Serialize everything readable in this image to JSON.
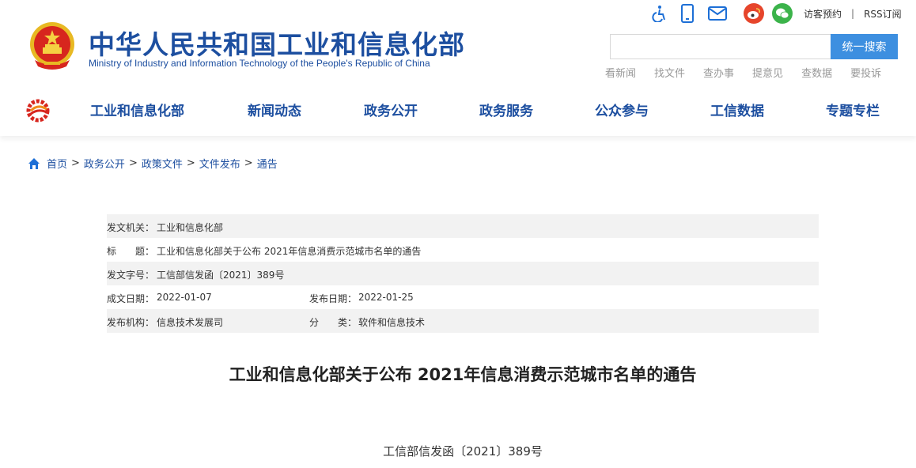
{
  "header": {
    "title_cn": "中华人民共和国工业和信息化部",
    "title_en": "Ministry of Industry and Information Technology of the People's Republic of China",
    "emblem_icon": "national-emblem-icon",
    "top_icons": [
      "accessibility-icon",
      "mobile-icon",
      "mail-icon",
      "weibo-icon",
      "wechat-icon"
    ],
    "visitor_booking": "访客预约",
    "separator": "|",
    "rss": "RSS订阅",
    "search_placeholder": "",
    "search_button": "统一搜索",
    "quick_links": [
      "看新闻",
      "找文件",
      "查办事",
      "提意见",
      "查数据",
      "要投诉"
    ],
    "colors": {
      "brand": "#1d4fa0",
      "search_button": "#3d8fe0",
      "weibo": "#e6452b",
      "wechat": "#3bb34a"
    }
  },
  "nav": {
    "logo_icon": "miit-logo-icon",
    "items": [
      "工业和信息化部",
      "新闻动态",
      "政务公开",
      "政务服务",
      "公众参与",
      "工信数据",
      "专题专栏"
    ]
  },
  "breadcrumb": {
    "home_icon": "home-icon",
    "items": [
      "首页",
      "政务公开",
      "政策文件",
      "文件发布",
      "通告"
    ],
    "separator": ">"
  },
  "info": {
    "issuer_label": "发文机关：",
    "issuer": "工业和信息化部",
    "title_label": "标　　题：",
    "title": "工业和信息化部关于公布 2021年信息消费示范城市名单的通告",
    "doc_no_label": "发文字号：",
    "doc_no": "工信部信发函〔2021〕389号",
    "created_label": "成文日期：",
    "created": "2022-01-07",
    "published_label": "发布日期：",
    "published": "2022-01-25",
    "org_label": "发布机构：",
    "org": "信息技术发展司",
    "category_label": "分　　类：",
    "category": "软件和信息技术"
  },
  "document": {
    "title": "工业和信息化部关于公布 2021年信息消费示范城市名单的通告",
    "number": "工信部信发函〔2021〕389号"
  }
}
